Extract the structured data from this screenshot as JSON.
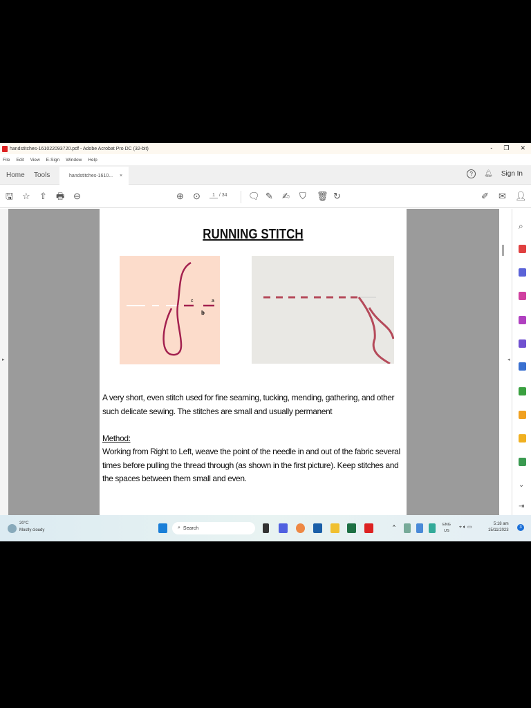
{
  "window": {
    "title": "handstitches-161022093720.pdf - Adobe Acrobat Pro DC (32-bit)",
    "controls": [
      "-",
      "❐",
      "✕"
    ]
  },
  "menu": [
    "File",
    "Edit",
    "View",
    "E-Sign",
    "Window",
    "Help"
  ],
  "tabs": {
    "home": "Home",
    "tools": "Tools",
    "document": "handstitches-1610...",
    "close": "×",
    "sign_in": "Sign In"
  },
  "toolbar": {
    "page_current": "1",
    "page_total": "/ 34"
  },
  "document": {
    "title": "RUNNING STITCH",
    "diagram_labels": {
      "a": "a",
      "b": "b",
      "c": "c"
    },
    "paragraph1": "A very short, even stitch used for fine seaming, tucking, mending, gathering, and other such delicate sewing. The stitches are small and usually permanent",
    "method_heading": "Method:",
    "method_text": "Working from Right to Left, weave the point of the needle in and out of the fabric several times before pulling the thread through (as shown in the first picture). Keep stitches and the spaces between them small and even."
  },
  "taskbar": {
    "weather_temp": "20°C",
    "weather_desc": "Mostly cloudy",
    "search": "Search",
    "lang": "ENG",
    "region": "US",
    "time": "5:18 am",
    "date": "15/11/2023",
    "notifications": "3"
  },
  "colors": {
    "thread": "#a3214f",
    "diagram_bg": "#fcdccb",
    "acrobat_red": "#d22"
  }
}
